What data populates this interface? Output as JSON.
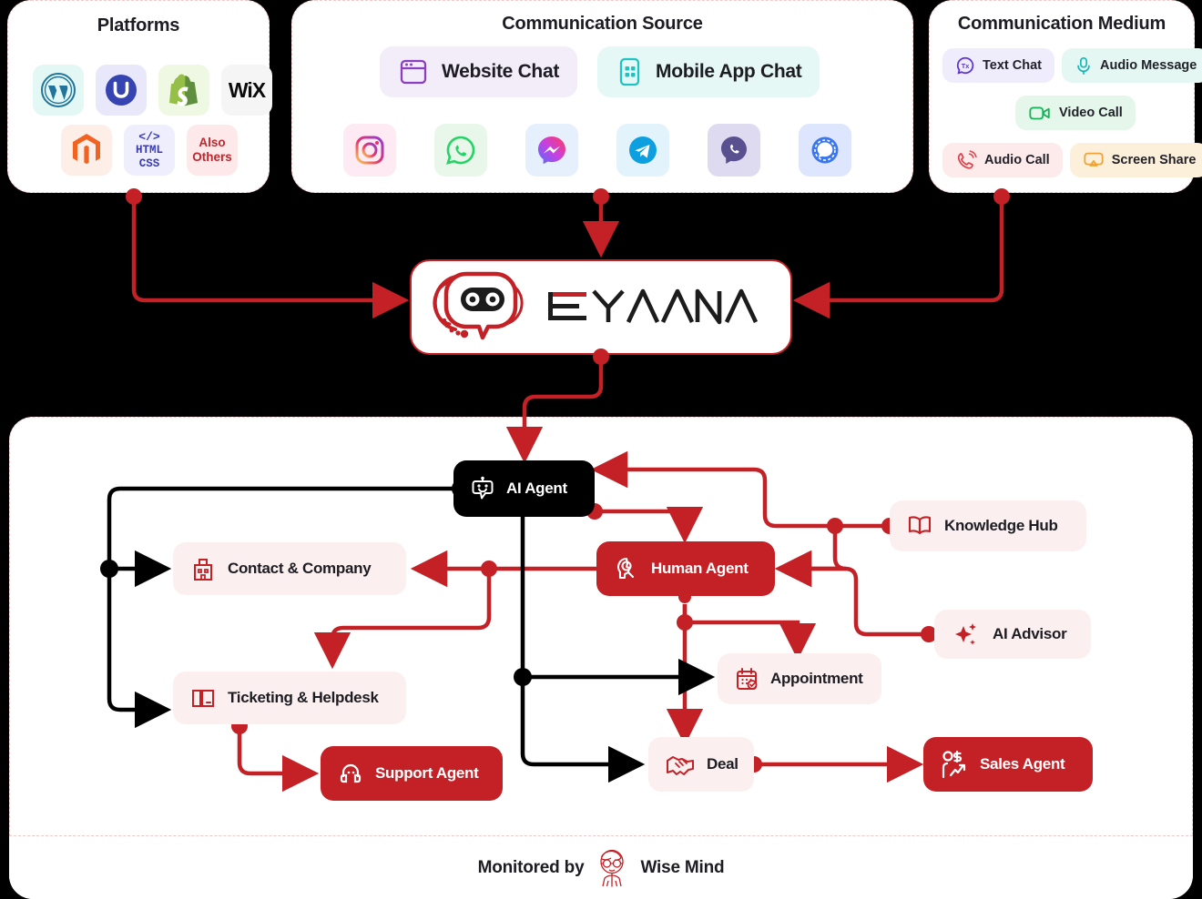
{
  "theme": {
    "accent": "#c42127",
    "black": "#000000",
    "soft": "#fbf0ef",
    "card_bg": "#ffffff",
    "page_bg": "#000000"
  },
  "panels": {
    "platforms": {
      "title": "Platforms",
      "items": [
        {
          "name": "wordpress-icon",
          "label": "WordPress",
          "bg": "#e3f7f5"
        },
        {
          "name": "umbraco-icon",
          "label": "Umbraco",
          "bg": "#e9e8fb"
        },
        {
          "name": "shopify-icon",
          "label": "Shopify",
          "bg": "#eef8e3"
        },
        {
          "name": "wix-icon",
          "label": "WiX",
          "bg": "#f5f5f5"
        },
        {
          "name": "magento-icon",
          "label": "Magento",
          "bg": "#fdeee7"
        },
        {
          "name": "htmlcss-icon",
          "label": "HTML CSS",
          "bg": "#eeeefc"
        },
        {
          "name": "also-others",
          "label": "Also Others",
          "bg": "#fde9ea"
        }
      ],
      "html_line1": "HTML",
      "html_line2": "CSS",
      "also_line1": "Also",
      "also_line2": "Others",
      "wix_text": "WiX"
    },
    "source": {
      "title": "Communication Source",
      "primary": [
        {
          "name": "website-chat",
          "label": "Website Chat",
          "bg": "#f3edf9",
          "icon": "#8b3fbf"
        },
        {
          "name": "mobile-app-chat",
          "label": "Mobile App Chat",
          "bg": "#e5f8f6",
          "icon": "#1fc3c3"
        }
      ],
      "apps": [
        {
          "name": "instagram-icon",
          "label": "Instagram",
          "bg": "#fdeaf2"
        },
        {
          "name": "whatsapp-icon",
          "label": "WhatsApp",
          "bg": "#e8f7ea"
        },
        {
          "name": "messenger-icon",
          "label": "Messenger",
          "bg": "#e6f0fd"
        },
        {
          "name": "telegram-icon",
          "label": "Telegram",
          "bg": "#e2f3fc"
        },
        {
          "name": "viber-icon",
          "label": "Viber",
          "bg": "#dedaf0"
        },
        {
          "name": "signal-icon",
          "label": "Signal",
          "bg": "#dde6fd"
        }
      ]
    },
    "medium": {
      "title": "Communication Medium",
      "items": [
        {
          "name": "text-chat",
          "label": "Text Chat",
          "bg": "#efecfc",
          "icon": "#5b33d4"
        },
        {
          "name": "audio-message",
          "label": "Audio Message",
          "bg": "#e4f7f3",
          "icon": "#17b8b8"
        },
        {
          "name": "video-call",
          "label": "Video Call",
          "bg": "#e4f7ea",
          "icon": "#18b35a"
        },
        {
          "name": "audio-call",
          "label": "Audio Call",
          "bg": "#fdeaea",
          "icon": "#e0404a"
        },
        {
          "name": "screen-share",
          "label": "Screen Share",
          "bg": "#fdf0db",
          "icon": "#eda53b"
        }
      ]
    }
  },
  "logo": {
    "brand": "EYAANA",
    "mascot": "robot-chat-mascot"
  },
  "flow": {
    "nodes": [
      {
        "name": "ai-agent",
        "label": "AI Agent",
        "style": "black",
        "icon": "robot-icon"
      },
      {
        "name": "contact-company",
        "label": "Contact & Company",
        "style": "soft",
        "icon": "building-icon"
      },
      {
        "name": "ticketing-helpdesk",
        "label": "Ticketing & Helpdesk",
        "style": "soft",
        "icon": "ticket-icon"
      },
      {
        "name": "support-agent",
        "label": "Support Agent",
        "style": "red",
        "icon": "headset-icon"
      },
      {
        "name": "human-agent",
        "label": "Human Agent",
        "style": "red",
        "icon": "agent-headset-icon"
      },
      {
        "name": "knowledge-hub",
        "label": "Knowledge Hub",
        "style": "soft",
        "icon": "book-icon"
      },
      {
        "name": "ai-advisor",
        "label": "AI Advisor",
        "style": "soft",
        "icon": "sparkle-icon"
      },
      {
        "name": "appointment",
        "label": "Appointment",
        "style": "soft",
        "icon": "calendar-icon"
      },
      {
        "name": "deal",
        "label": "Deal",
        "style": "soft",
        "icon": "handshake-icon"
      },
      {
        "name": "sales-agent",
        "label": "Sales Agent",
        "style": "red",
        "icon": "sales-chart-icon"
      }
    ]
  },
  "footer": {
    "prefix": "Monitored  by",
    "brand": "Wise Mind",
    "avatar": "wise-mind-face-icon"
  }
}
